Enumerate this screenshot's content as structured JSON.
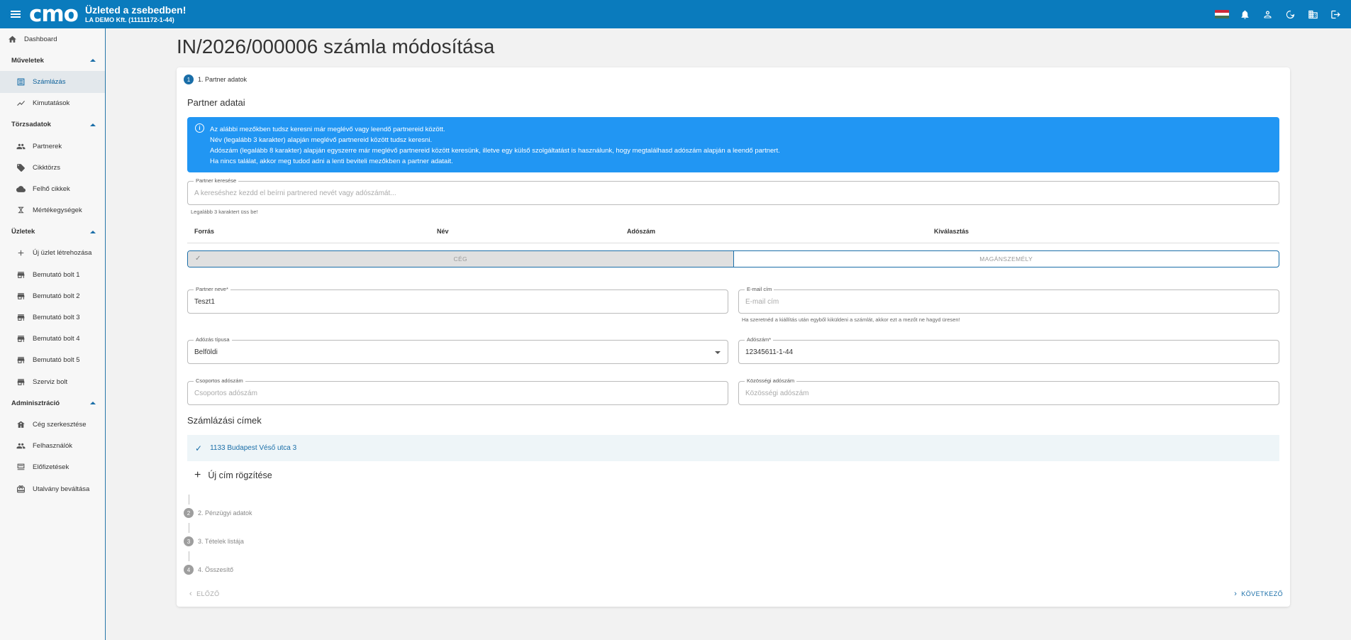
{
  "header": {
    "logo": "cmo",
    "app_title": "Üzleted a zsebedben!",
    "company": "LA DEMO Kft. (11111172-1-44)",
    "flag_colors": [
      "#ce2939",
      "#ffffff",
      "#477050"
    ]
  },
  "sidebar": {
    "dashboard": "Dashboard",
    "sections": {
      "muveletek": "Műveletek",
      "torzsadatok": "Törzsadatok",
      "uzletek": "Üzletek",
      "adminisztracio": "Adminisztráció"
    },
    "items": {
      "szamlazas": "Számlázás",
      "kimutatasok": "Kimutatások",
      "partnerek": "Partnerek",
      "cikktorzs": "Cikktörzs",
      "felho_cikkek": "Felhő cikkek",
      "mertekegysegek": "Mértékegységek",
      "uj_uzlet": "Új üzlet létrehozása",
      "bolt1": "Bemutató bolt 1",
      "bolt2": "Bemutató bolt 2",
      "bolt3": "Bemutató bolt 3",
      "bolt4": "Bemutató bolt 4",
      "bolt5": "Bemutató bolt 5",
      "szerviz": "Szerviz bolt",
      "ceg": "Cég szerkesztése",
      "felhasznalok": "Felhasználók",
      "elofizetesek": "Előfizetések",
      "utalvany": "Utalvány beváltása"
    }
  },
  "page": {
    "title": "IN/2026/000006 számla módosítása"
  },
  "steps": [
    {
      "num": "1",
      "label": "1. Partner adatok"
    },
    {
      "num": "2",
      "label": "2. Pénzügyi adatok"
    },
    {
      "num": "3",
      "label": "3. Tételek listája"
    },
    {
      "num": "4",
      "label": "4. Összesítő"
    }
  ],
  "partner": {
    "section_title": "Partner adatai",
    "info_lines": [
      "Az alábbi mezőkben tudsz keresni már meglévő vagy leendő partnereid között.",
      "Név (legalább 3 karakter) alapján meglévő partnereid között tudsz keresni.",
      "Adószám (legalább 8 karakter) alapján egyszerre már meglévő partnereid között keresünk, illetve egy külső szolgáltatást is használunk, hogy megtalálhasd adószám alapján a leendő partnert.",
      "Ha nincs találat, akkor meg tudod adni a lenti beviteli mezőkben a partner adatait."
    ],
    "search": {
      "label": "Partner keresése",
      "placeholder": "A kereséshez kezdd el beírni partnered nevét vagy adószámát...",
      "hint": "Legalább 3 karaktert üss be!"
    },
    "results_columns": {
      "forras": "Forrás",
      "nev": "Név",
      "adoszam": "Adószám",
      "kivalasztas": "Kiválasztás"
    },
    "type_toggle": {
      "ceg": "CÉG",
      "maganszemely": "MAGÁNSZEMÉLY"
    },
    "name_field": {
      "label": "Partner neve*",
      "value": "Teszt1"
    },
    "email_field": {
      "label": "E-mail cím",
      "placeholder": "E-mail cím",
      "hint": "Ha szeretnéd a kiállítás után egyből kiküldeni a számlát, akkor ezt a mezőt ne hagyd üresen!"
    },
    "tax_type_field": {
      "label": "Adózás típusa",
      "value": "Belföldi"
    },
    "tax_number_field": {
      "label": "Adószám*",
      "value": "12345611-1-44"
    },
    "group_tax_field": {
      "label": "Csoportos adószám",
      "placeholder": "Csoportos adószám"
    },
    "eu_tax_field": {
      "label": "Közösségi adószám",
      "placeholder": "Közösségi adószám"
    }
  },
  "billing": {
    "section_title": "Számlázási címek",
    "address": "1133 Budapest Véső utca 3",
    "new_address": "Új cím rögzítése"
  },
  "footer": {
    "prev": "ELŐZŐ",
    "next": "KÖVETKEZŐ"
  }
}
